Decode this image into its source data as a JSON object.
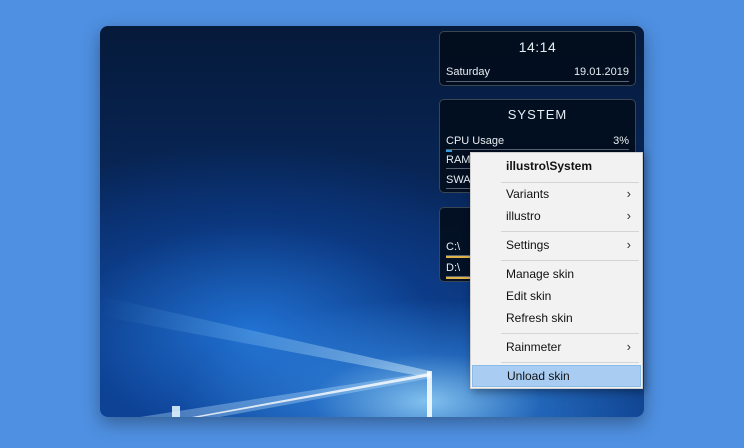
{
  "clock": {
    "time": "14:14",
    "day": "Saturday",
    "date": "19.01.2019"
  },
  "system": {
    "title": "SYSTEM",
    "cpu": {
      "label": "CPU Usage",
      "value": "3%",
      "level": 0.03
    },
    "ram": {
      "label": "RAM"
    },
    "swap": {
      "label": "SWAP"
    }
  },
  "disk": {
    "drives": [
      "C:\\",
      "D:\\"
    ]
  },
  "context_menu": {
    "header": "illustro\\System",
    "variants": "Variants",
    "illustro": "illustro",
    "settings": "Settings",
    "manage": "Manage skin",
    "edit": "Edit skin",
    "refresh": "Refresh skin",
    "rainmeter": "Rainmeter",
    "unload": "Unload skin",
    "chevron": "›"
  },
  "colors": {
    "page_bg": "#4f90e2",
    "highlight": "#a9cdf2",
    "system_bar": "#2f9ce0",
    "disk_bar": "#e0b24a"
  }
}
